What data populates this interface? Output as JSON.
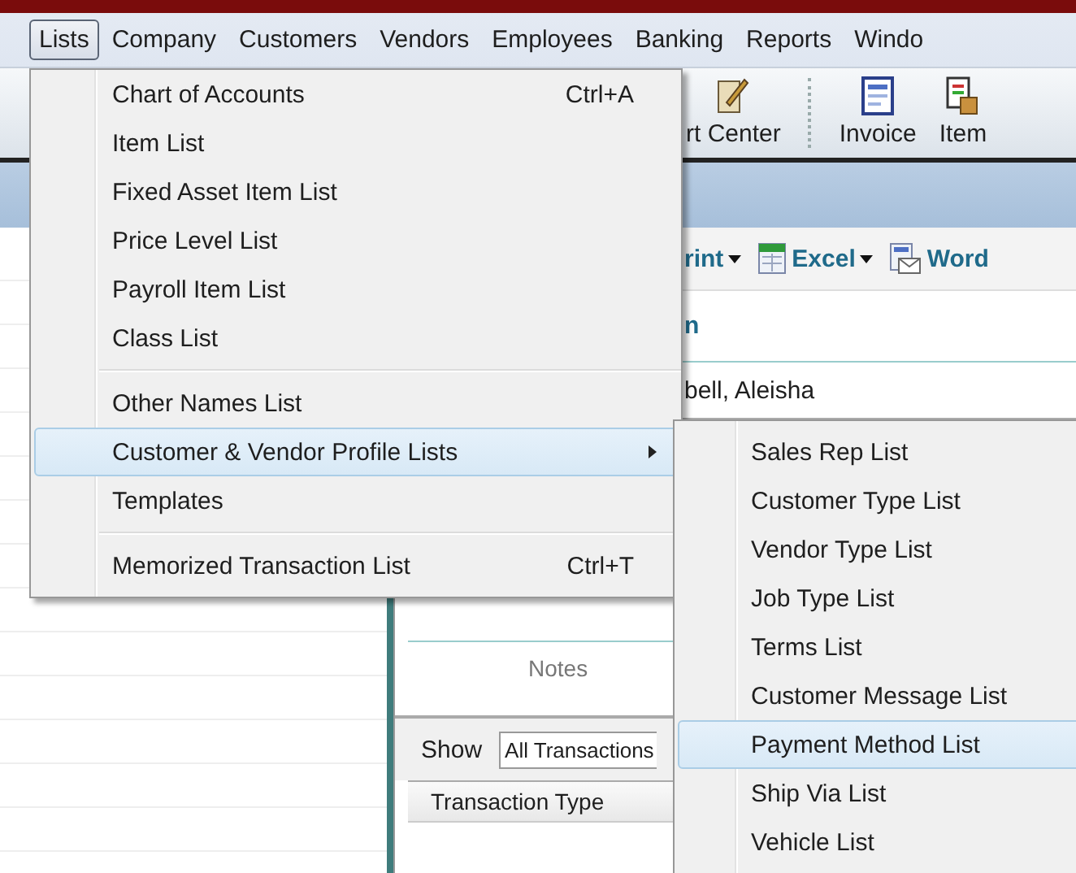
{
  "menubar": [
    {
      "label": "Lists",
      "selected": true
    },
    {
      "label": "Company",
      "selected": false
    },
    {
      "label": "Customers",
      "selected": false
    },
    {
      "label": "Vendors",
      "selected": false
    },
    {
      "label": "Employees",
      "selected": false
    },
    {
      "label": "Banking",
      "selected": false
    },
    {
      "label": "Reports",
      "selected": false
    },
    {
      "label": "Windo",
      "selected": false
    }
  ],
  "toolbar": [
    {
      "label": "rt Center",
      "kind": "center"
    },
    {
      "label": "Invoice",
      "kind": "invoice"
    },
    {
      "label": "Item",
      "kind": "item"
    }
  ],
  "detail": {
    "actions": [
      {
        "label": "rint",
        "kind": "print",
        "dropdown": true
      },
      {
        "label": "Excel",
        "kind": "excel",
        "dropdown": true
      },
      {
        "label": "Word",
        "kind": "word",
        "dropdown": false
      }
    ],
    "heading": "n",
    "name": "bell, Aleisha",
    "notes_label": "Notes",
    "show_label": "Show",
    "show_value": "All Transactions",
    "column_1": "Transaction Type"
  },
  "menu": [
    {
      "kind": "item",
      "label": "Chart of Accounts",
      "shortcut": "Ctrl+A",
      "submenu": false,
      "selected": false
    },
    {
      "kind": "item",
      "label": "Item List",
      "submenu": false,
      "selected": false
    },
    {
      "kind": "item",
      "label": "Fixed Asset Item List",
      "submenu": false,
      "selected": false
    },
    {
      "kind": "item",
      "label": "Price Level List",
      "submenu": false,
      "selected": false
    },
    {
      "kind": "item",
      "label": "Payroll Item List",
      "submenu": false,
      "selected": false
    },
    {
      "kind": "item",
      "label": "Class List",
      "submenu": false,
      "selected": false
    },
    {
      "kind": "separator"
    },
    {
      "kind": "item",
      "label": "Other Names List",
      "submenu": false,
      "selected": false
    },
    {
      "kind": "item",
      "label": "Customer & Vendor Profile Lists",
      "submenu": true,
      "selected": true
    },
    {
      "kind": "item",
      "label": "Templates",
      "submenu": false,
      "selected": false
    },
    {
      "kind": "separator"
    },
    {
      "kind": "item",
      "label": "Memorized Transaction List",
      "shortcut": "Ctrl+T",
      "submenu": false,
      "selected": false
    }
  ],
  "submenu": [
    {
      "label": "Sales Rep List",
      "selected": false
    },
    {
      "label": "Customer Type List",
      "selected": false
    },
    {
      "label": "Vendor Type List",
      "selected": false
    },
    {
      "label": "Job Type List",
      "selected": false
    },
    {
      "label": "Terms List",
      "selected": false
    },
    {
      "label": "Customer Message List",
      "selected": false
    },
    {
      "label": "Payment Method List",
      "selected": true
    },
    {
      "label": "Ship Via List",
      "selected": false
    },
    {
      "label": "Vehicle List",
      "selected": false
    }
  ]
}
